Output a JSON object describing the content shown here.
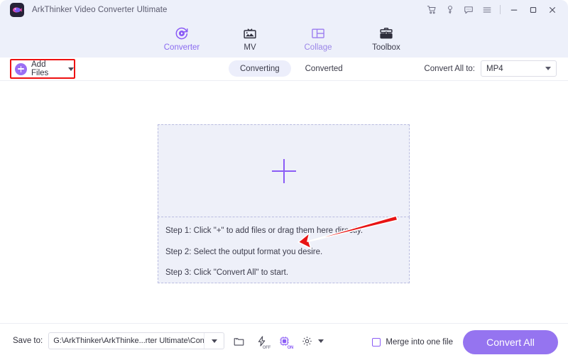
{
  "window": {
    "title": "ArkThinker Video Converter Ultimate",
    "logo_icon": "app-logo-icon",
    "titlebar_icons": [
      {
        "name": "cart-icon",
        "glyph": "cart"
      },
      {
        "name": "key-icon",
        "glyph": "key"
      },
      {
        "name": "feedback-icon",
        "glyph": "chat"
      },
      {
        "name": "menu-icon",
        "glyph": "hamburger"
      }
    ],
    "controls": {
      "minimize": "minimize-button",
      "maximize": "maximize-button",
      "close": "close-button"
    }
  },
  "nav": {
    "tabs": [
      {
        "label": "Converter",
        "icon": "converter-icon",
        "active": true
      },
      {
        "label": "MV",
        "icon": "mv-icon",
        "active": false
      },
      {
        "label": "Collage",
        "icon": "collage-icon",
        "active": false
      },
      {
        "label": "Toolbox",
        "icon": "toolbox-icon",
        "active": false
      }
    ]
  },
  "toolbar": {
    "add_files_label": "Add Files",
    "add_files_highlighted": true,
    "highlight_color": "#ee1111",
    "segments": [
      {
        "label": "Converting",
        "active": true
      },
      {
        "label": "Converted",
        "active": false
      }
    ],
    "convert_all_to_label": "Convert All to:",
    "output_format": "MP4"
  },
  "dropzone": {
    "plus_icon": "add-plus-icon",
    "steps": [
      "Step 1: Click \"+\" to add files or drag them here directly.",
      "Step 2: Select the output format you desire.",
      "Step 3: Click \"Convert All\" to start."
    ],
    "annotation": {
      "type": "arrow",
      "color": "#e81414",
      "points_to": "add-plus-icon"
    }
  },
  "bottom": {
    "save_to_label": "Save to:",
    "save_path": "G:\\ArkThinker\\ArkThinke...rter Ultimate\\Converted",
    "icons": [
      {
        "name": "open-folder-icon",
        "badge": ""
      },
      {
        "name": "hardware-acceleration-icon",
        "badge": "OFF"
      },
      {
        "name": "gpu-icon",
        "badge": "ON"
      },
      {
        "name": "settings-gear-icon",
        "badge": ""
      }
    ],
    "merge_label": "Merge into one file",
    "merge_checked": false,
    "convert_all_label": "Convert All"
  },
  "colors": {
    "accent": "#8b5cf6",
    "button": "#9574f0",
    "header_bg": "#edf0fa",
    "dropzone_bg": "#eef0f9",
    "annotation_red": "#ee1111"
  }
}
